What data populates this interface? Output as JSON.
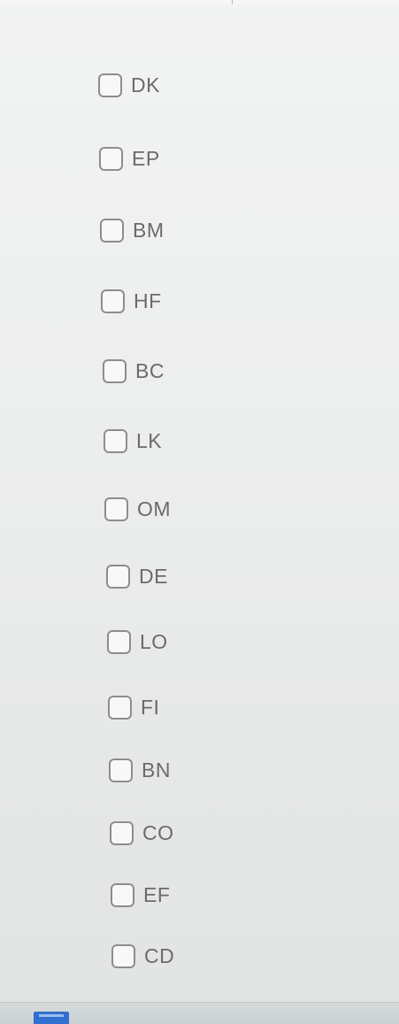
{
  "checkbox_list": {
    "options": [
      {
        "label": "DK",
        "checked": false
      },
      {
        "label": "EP",
        "checked": false
      },
      {
        "label": "BM",
        "checked": false
      },
      {
        "label": "HF",
        "checked": false
      },
      {
        "label": "BC",
        "checked": false
      },
      {
        "label": "LK",
        "checked": false
      },
      {
        "label": "OM",
        "checked": false
      },
      {
        "label": "DE",
        "checked": false
      },
      {
        "label": "LO",
        "checked": false
      },
      {
        "label": "FI",
        "checked": false
      },
      {
        "label": "BN",
        "checked": false
      },
      {
        "label": "CO",
        "checked": false
      },
      {
        "label": "EF",
        "checked": false
      },
      {
        "label": "CD",
        "checked": false
      }
    ]
  },
  "taskbar": {
    "app_icon": "app-icon"
  },
  "colors": {
    "background": "#eceded",
    "checkbox_border": "#8d8d8d",
    "label_text": "#6b6b6b",
    "taskbar": "#cfd4d5",
    "taskbar_icon": "#2f6fcf"
  }
}
